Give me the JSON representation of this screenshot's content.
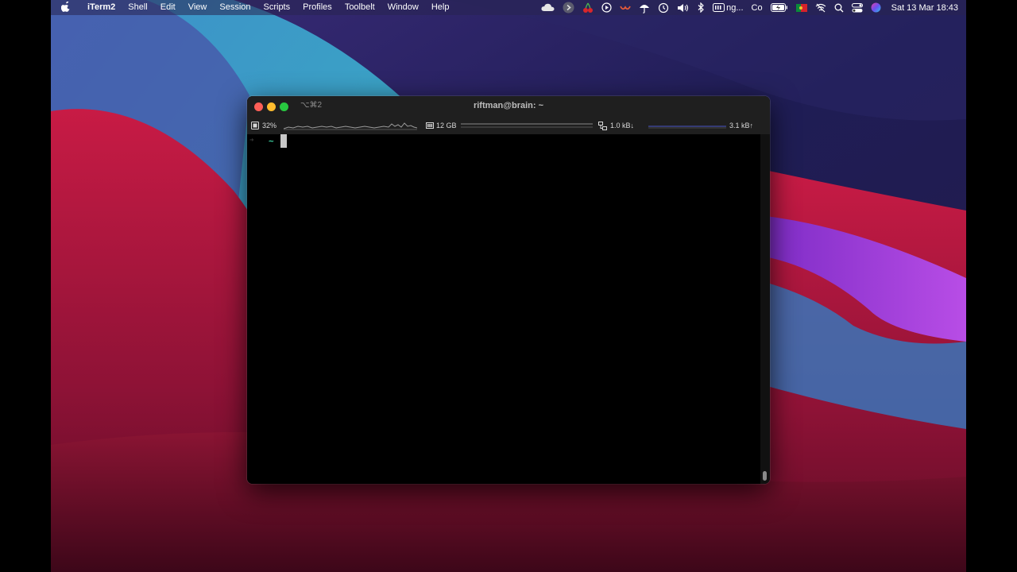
{
  "menubar": {
    "app_name": "iTerm2",
    "menus": [
      "Shell",
      "Edit",
      "View",
      "Session",
      "Scripts",
      "Profiles",
      "Toolbelt",
      "Window",
      "Help"
    ],
    "status_text_1": "ng...",
    "status_text_2": "Co",
    "clock": "Sat 13 Mar  18:43"
  },
  "window": {
    "shortcut": "⌥⌘2",
    "title": "riftman@brain: ~"
  },
  "status_bar": {
    "cpu": "32%",
    "memory": "12 GB",
    "net_down": "1.0 kB↓",
    "net_up": "3.1 kB↑"
  },
  "terminal": {
    "prompt_arrow": "➜",
    "prompt_dir": "~"
  },
  "colors": {
    "accent_green": "#3fd7a5",
    "close": "#fe5f57",
    "minimize": "#febc2e",
    "zoom": "#28c840"
  }
}
